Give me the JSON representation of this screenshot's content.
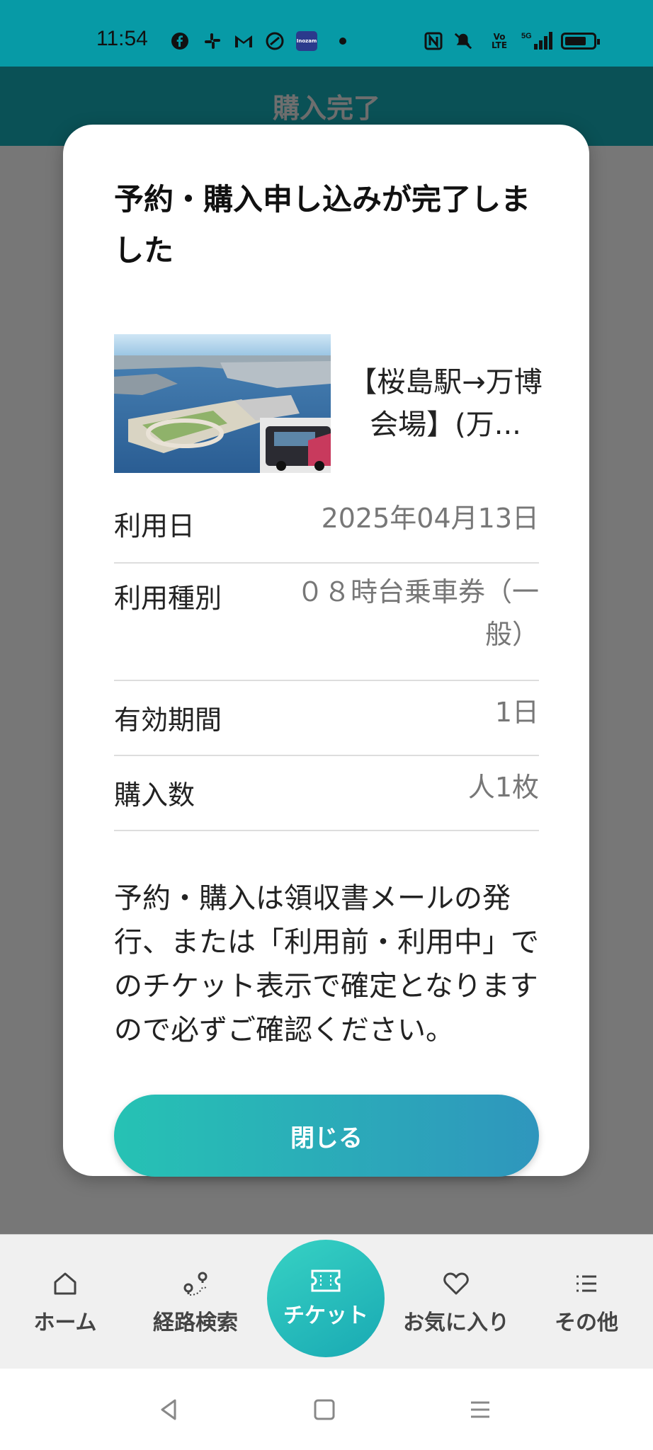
{
  "status_bar": {
    "time": "11:54",
    "notification_icons": [
      "facebook-icon",
      "slack-icon",
      "gmail-icon",
      "app-icon",
      "app-badge-icon",
      "dot-icon"
    ],
    "app_badge_text": "Inozam",
    "system_icons": [
      "nfc-icon",
      "mute-icon",
      "volte-icon",
      "signal-5g-icon",
      "battery-icon"
    ],
    "volte_text": "Vo LTE",
    "network_text": "5G",
    "battery_level": 0.75
  },
  "header": {
    "title": "購入完了"
  },
  "modal": {
    "title": "予約・購入申し込みが完了しました",
    "ticket_name": "【桜島駅→万博会場】(万...",
    "details": [
      {
        "label": "利用日",
        "value": "2025年04月13日"
      },
      {
        "label": "利用種別",
        "value": "０８時台乗車券（一般）"
      },
      {
        "label": "有効期間",
        "value": "1日"
      },
      {
        "label": "購入数",
        "value": "人1枚"
      }
    ],
    "notice": "予約・購入は領収書メールの発行、または「利用前・利用中」でのチケット表示で確定となりますので必ずご確認ください。",
    "close_button": "閉じる"
  },
  "bottom_nav": {
    "items": [
      {
        "label": "ホーム",
        "icon": "home-icon"
      },
      {
        "label": "経路検索",
        "icon": "route-search-icon"
      },
      {
        "label": "チケット",
        "icon": "ticket-icon"
      },
      {
        "label": "お気に入り",
        "icon": "heart-icon"
      },
      {
        "label": "その他",
        "icon": "list-icon"
      }
    ],
    "active": "チケット"
  },
  "colors": {
    "status_bar": "#079aa6",
    "header": "#0a5156",
    "accent_start": "#26c2b4",
    "accent_end": "#2f96bd"
  }
}
